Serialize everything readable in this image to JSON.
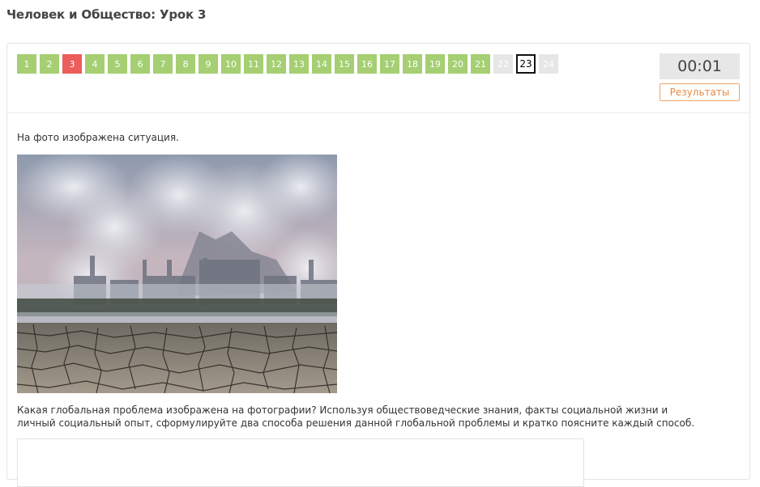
{
  "page": {
    "title": "Человек и Общество: Урок 3"
  },
  "nav": {
    "questions": [
      {
        "label": "1",
        "state": "done"
      },
      {
        "label": "2",
        "state": "done"
      },
      {
        "label": "3",
        "state": "wrong"
      },
      {
        "label": "4",
        "state": "done"
      },
      {
        "label": "5",
        "state": "done"
      },
      {
        "label": "6",
        "state": "done"
      },
      {
        "label": "7",
        "state": "done"
      },
      {
        "label": "8",
        "state": "done"
      },
      {
        "label": "9",
        "state": "done"
      },
      {
        "label": "10",
        "state": "done"
      },
      {
        "label": "11",
        "state": "done"
      },
      {
        "label": "12",
        "state": "done"
      },
      {
        "label": "13",
        "state": "done"
      },
      {
        "label": "14",
        "state": "done"
      },
      {
        "label": "15",
        "state": "done"
      },
      {
        "label": "16",
        "state": "done"
      },
      {
        "label": "17",
        "state": "done"
      },
      {
        "label": "18",
        "state": "done"
      },
      {
        "label": "19",
        "state": "done"
      },
      {
        "label": "20",
        "state": "done"
      },
      {
        "label": "21",
        "state": "done"
      },
      {
        "label": "22",
        "state": "todo"
      },
      {
        "label": "23",
        "state": "current"
      },
      {
        "label": "24",
        "state": "todo"
      }
    ]
  },
  "timer": {
    "value": "00:01"
  },
  "results_button": {
    "label": "Результаты"
  },
  "content": {
    "intro": "На фото изображена ситуация.",
    "question": "Какая глобальная проблема изображена на фотографии? Используя обществоведческие знания, факты социальной жизни и личный социальный опыт, сформулируйте два способа решения данной глобальной проблемы и кратко поясните каждый способ.",
    "answer_value": ""
  },
  "colors": {
    "done": "#a5cf72",
    "wrong": "#ec5d5b",
    "todo": "#e6e6e6",
    "current_border": "#111111",
    "results_accent": "#e88a45"
  }
}
